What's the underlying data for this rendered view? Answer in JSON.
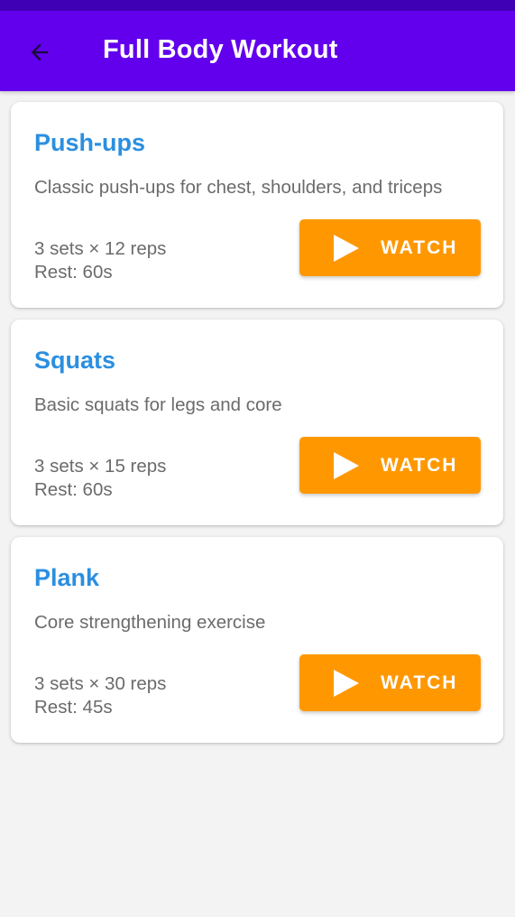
{
  "app_bar": {
    "title": "Full Body Workout",
    "back_icon": "arrow-back-icon",
    "color": "#6200ee",
    "status_bar_color": "#3f00b5"
  },
  "colors": {
    "title_accent": "#2b8fe0",
    "button": "#ff9800",
    "background": "#f3f3f3"
  },
  "exercises": [
    {
      "title": "Push-ups",
      "description": "Classic push-ups for chest, shoulders, and triceps",
      "sets": "3 sets × 12 reps",
      "rest": "Rest: 60s",
      "button_label": "WATCH",
      "button_icon": "play-icon"
    },
    {
      "title": "Squats",
      "description": "Basic squats for legs and core",
      "sets": "3 sets × 15 reps",
      "rest": "Rest: 60s",
      "button_label": "WATCH",
      "button_icon": "play-icon"
    },
    {
      "title": "Plank",
      "description": "Core strengthening exercise",
      "sets": "3 sets × 30 reps",
      "rest": "Rest: 45s",
      "button_label": "WATCH",
      "button_icon": "play-icon"
    }
  ]
}
